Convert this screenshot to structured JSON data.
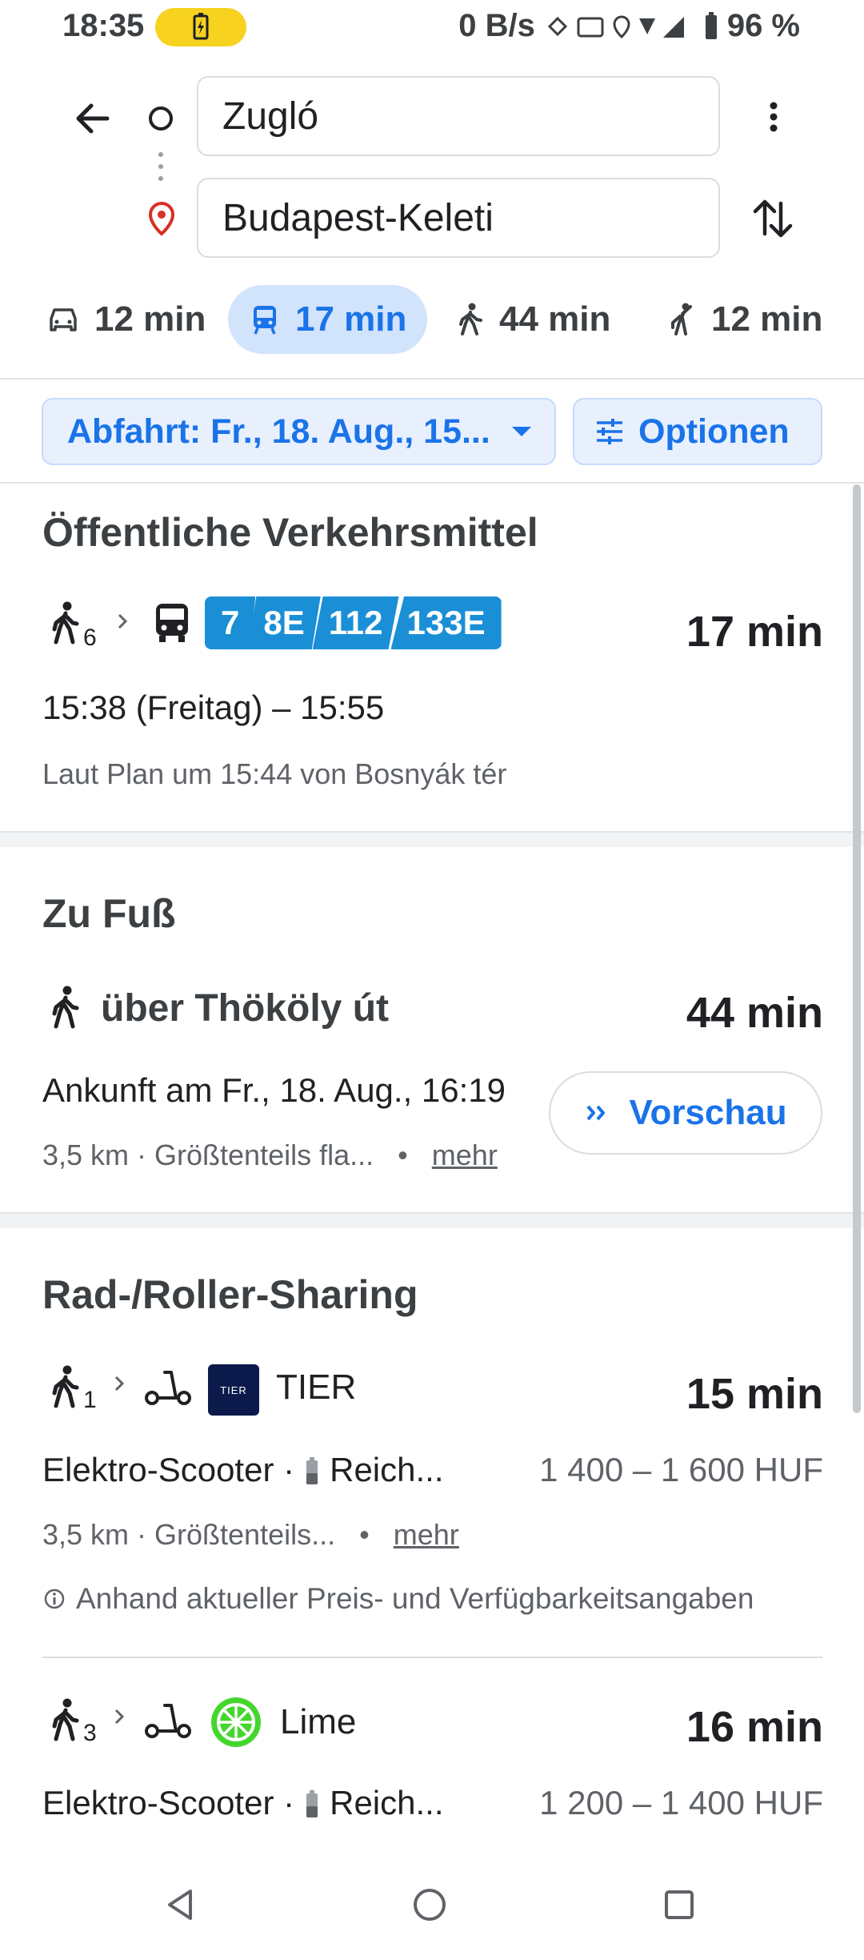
{
  "status_bar": {
    "time": "18:35",
    "net_speed": "0 B/s",
    "battery": "96 %"
  },
  "route": {
    "origin": "Zugló",
    "destination": "Budapest-Keleti"
  },
  "modes": [
    {
      "icon": "car-icon",
      "label": "12 min"
    },
    {
      "icon": "transit-icon",
      "label": "17 min"
    },
    {
      "icon": "walk-icon",
      "label": "44 min"
    },
    {
      "icon": "rideshare-icon",
      "label": "12 min"
    }
  ],
  "filters": {
    "departure": "Abfahrt: Fr., 18. Aug., 15...",
    "options": "Optionen"
  },
  "transit": {
    "heading": "Öffentliche Verkehrsmittel",
    "walk_minutes": "6",
    "lines": [
      "7",
      "8E",
      "112",
      "133E"
    ],
    "duration": "17 min",
    "times": "15:38 (Freitag) – 15:55",
    "note": "Laut Plan um 15:44 von Bosnyák tér"
  },
  "walking": {
    "heading": "Zu Fuß",
    "via": "über Thököly út",
    "duration": "44 min",
    "arrival": "Ankunft am Fr., 18. Aug., 16:19",
    "details": "3,5 km · Größtenteils fla...",
    "more": "mehr",
    "preview": "Vorschau"
  },
  "sharing": {
    "heading": "Rad-/Roller-Sharing",
    "options": [
      {
        "walk_minutes": "1",
        "provider": "TIER",
        "logo_text": "TIER",
        "duration": "15 min",
        "vehicle": "Elektro-Scooter ·",
        "range": "Reich...",
        "price": "1 400 – 1 600 HUF",
        "details": "3,5 km · Größtenteils...",
        "more": "mehr",
        "info": "Anhand aktueller Preis- und Verfügbarkeitsangaben"
      },
      {
        "walk_minutes": "3",
        "provider": "Lime",
        "duration": "16 min",
        "vehicle": "Elektro-Scooter ·",
        "range": "Reich...",
        "price": "1 200 – 1 400 HUF"
      }
    ]
  },
  "colors": {
    "accent": "#1a73e8",
    "transit_badge": "#1a8fd6",
    "tier_logo": "#0c1a4b",
    "lime_logo": "#44d62c",
    "destination_pin": "#d93025"
  }
}
